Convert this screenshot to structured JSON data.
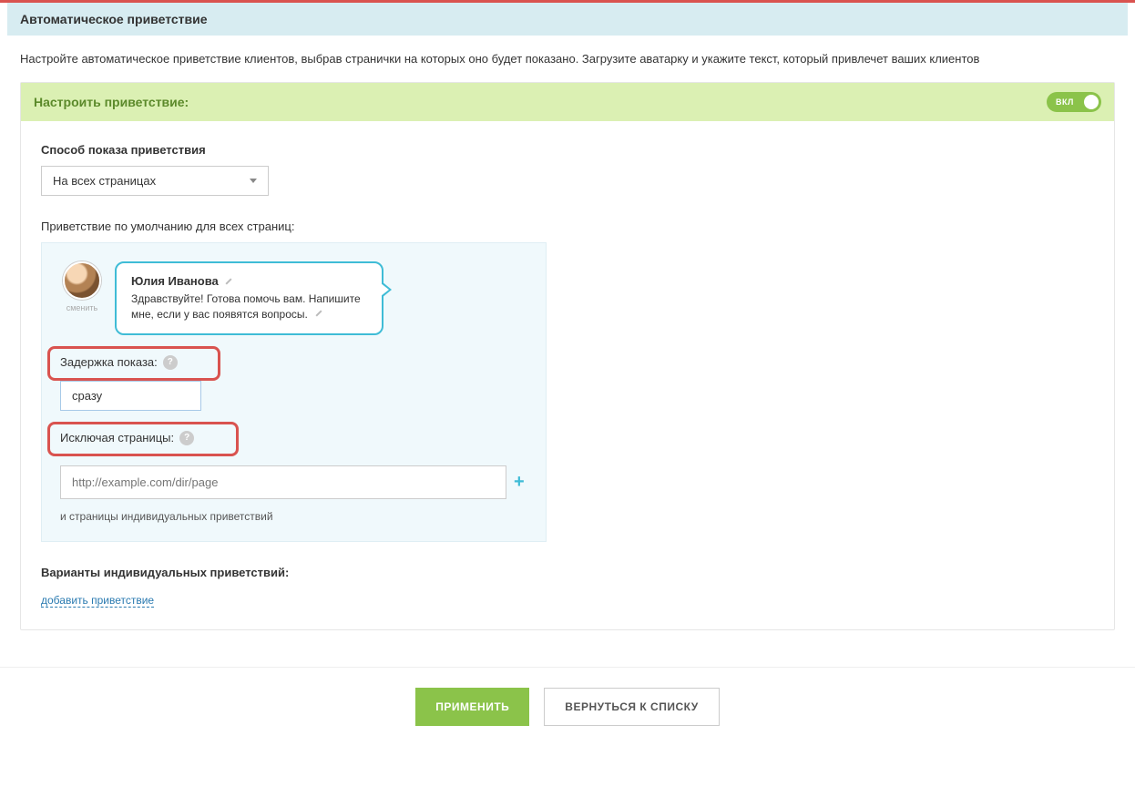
{
  "header": {
    "title": "Автоматическое приветствие"
  },
  "intro": "Настройте автоматическое приветствие клиентов, выбрав странички на которых оно будет показано. Загрузите аватарку и укажите текст, который привлечет ваших клиентов",
  "settings": {
    "title": "Настроить приветствие:",
    "toggle": {
      "label": "ВКЛ",
      "on": true
    }
  },
  "display_method": {
    "label": "Способ показа приветствия",
    "value": "На всех страницах"
  },
  "default_greeting": {
    "label": "Приветствие по умолчанию для всех страниц:",
    "operator": {
      "name": "Юлия Иванова",
      "change_label": "сменить",
      "message": "Здравствуйте! Готова помочь вам. Напишите мне, если у вас появятся вопросы."
    },
    "delay": {
      "label": "Задержка показа:",
      "value": "сразу"
    },
    "exclude": {
      "label": "Исключая страницы:",
      "placeholder": "http://example.com/dir/page",
      "note": "и страницы индивидуальных приветствий"
    }
  },
  "variants": {
    "label": "Варианты индивидуальных приветствий:",
    "add_link": "добавить приветствие"
  },
  "footer": {
    "apply": "ПРИМЕНИТЬ",
    "back": "ВЕРНУТЬСЯ К СПИСКУ"
  }
}
